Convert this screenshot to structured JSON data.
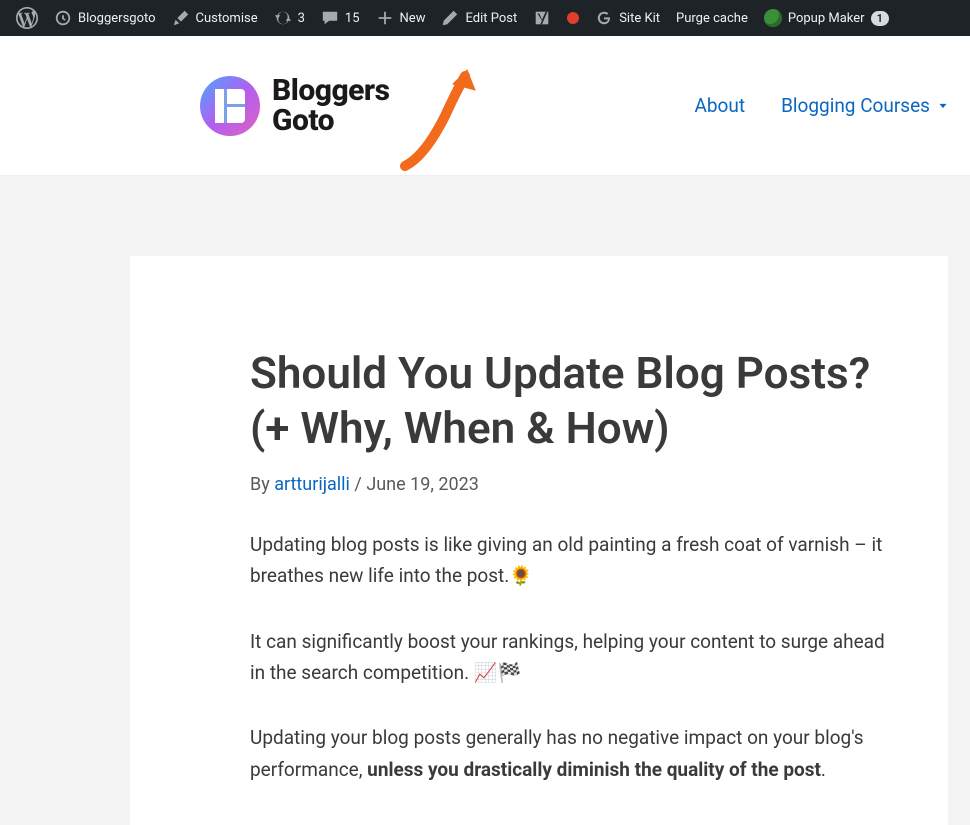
{
  "adminbar": {
    "site_name": "Bloggersgoto",
    "customise": "Customise",
    "updates_count": "3",
    "comments_count": "15",
    "new_label": "New",
    "edit_post": "Edit Post",
    "sitekit": "Site Kit",
    "purge": "Purge cache",
    "popup_maker": "Popup Maker",
    "popup_badge": "1"
  },
  "logo": {
    "line1": "Bloggers",
    "line2": "Goto"
  },
  "nav": {
    "about": "About",
    "courses": "Blogging Courses"
  },
  "post": {
    "title": "Should You Update Blog Posts? (+ Why, When & How)",
    "by": "By ",
    "author": "artturijalli",
    "sep": " / ",
    "date": "June 19, 2023",
    "p1": "Updating blog posts is like giving an old painting a fresh coat of varnish – it breathes new life into the post.🌻",
    "p2": "It can significantly boost your rankings, helping your content to surge ahead in the search competition. 📈🏁",
    "p3a": "Updating your blog posts generally has no negative impact on your blog's performance, ",
    "p3b": "unless you drastically diminish the quality of the post",
    "p3c": "."
  }
}
